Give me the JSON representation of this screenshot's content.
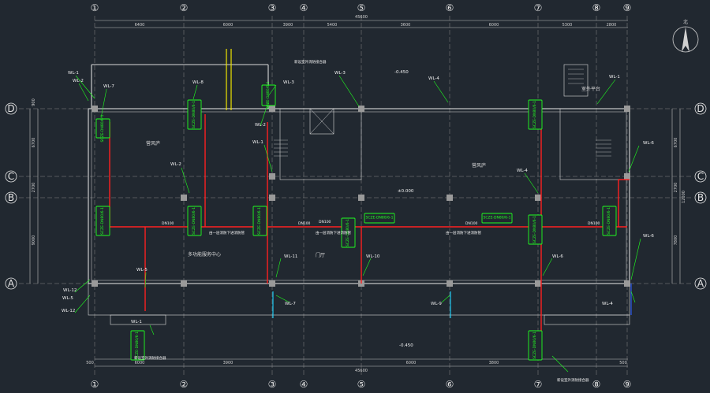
{
  "axes": {
    "columns": [
      "①",
      "②",
      "③",
      "④",
      "⑤",
      "⑥",
      "⑦",
      "⑧",
      "⑨"
    ],
    "rows": [
      "D",
      "C",
      "B",
      "A"
    ]
  },
  "dimensions": {
    "top_total": "45600",
    "top": [
      "6400",
      "6000",
      "3900",
      "5400",
      "3600",
      "6000",
      "5300",
      "2800"
    ],
    "bottom_total": "45600",
    "bottom": [
      "500",
      "6000",
      "3900",
      "6000",
      "3800",
      "500"
    ],
    "left": [
      "900",
      "6700",
      "2700",
      "9000"
    ],
    "right": [
      "6700",
      "2700",
      "7800",
      "12000"
    ]
  },
  "rooms": [
    "营风庐",
    "营风庐",
    "多功能服务中心",
    "门厅",
    "室外平台"
  ],
  "elevations": [
    "-0.450",
    "±0.000",
    "-0.450",
    "-0.450"
  ],
  "pipe_labels": [
    "WL-1",
    "WL-2",
    "WL-7",
    "WL-8",
    "WL-3",
    "WL-2",
    "WL-1",
    "WL-2",
    "WL-3",
    "WL-4",
    "WL-1",
    "WL-4",
    "WL-6",
    "WL-6",
    "WL-5",
    "WL-12",
    "WL-11",
    "WL-10",
    "WL-6",
    "WL-7",
    "WL-9",
    "WL-4",
    "WL-5",
    "WL-1",
    "WL-12"
  ],
  "equipment_tag": "SCZE-DN80/6-1",
  "pipe_sizes": [
    "DN100",
    "DN100",
    "DN100",
    "DN100",
    "DN100"
  ],
  "notes": {
    "left_mid": "由一层消防下进消防管",
    "mid": "由一层消防下进消防管",
    "mid2": "由一层消防下进消防管",
    "top_note": "新设室外消防接合器",
    "bottom_left": "新设室外消防接合器",
    "bottom_right": "新设室外消防接合器"
  },
  "compass": "北"
}
